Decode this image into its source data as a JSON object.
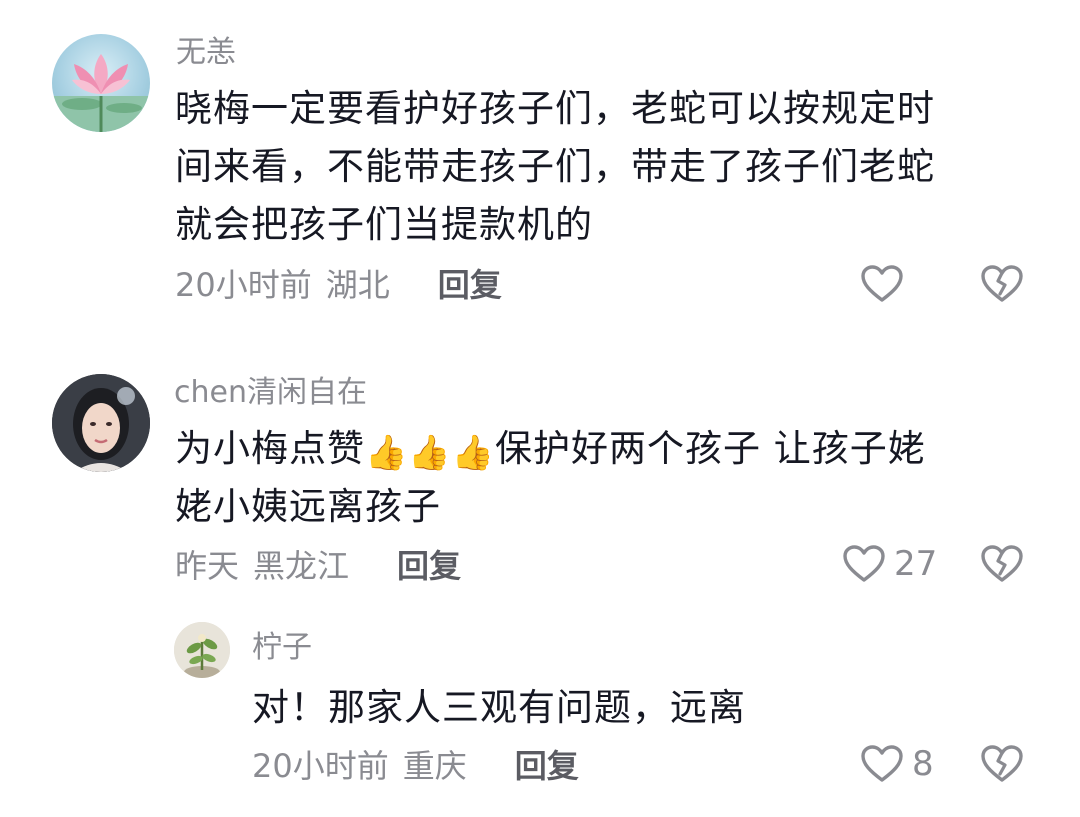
{
  "comments": [
    {
      "username": "无恙",
      "text": "晓梅一定要看护好孩子们，老蛇可以按规定时间来看，不能带走孩子们，带走了孩子们老蛇就会把孩子们当提款机的",
      "lines": [
        "晓梅一定要看护好孩子们，老蛇可以按规定时",
        "间来看，不能带走孩子们，带走了孩子们老蛇",
        "就会把孩子们当提款机的"
      ],
      "time": "20小时前",
      "location": "湖北",
      "reply_label": "回复",
      "like_count": "",
      "avatar_icon": "lotus-flower-avatar"
    },
    {
      "username": "chen清闲自在",
      "line1_before": "为小梅点赞",
      "emojis": [
        "👍",
        "👍",
        "👍"
      ],
      "line1_after": "保护好两个孩子 让孩子姥",
      "line2": "姥小姨远离孩子",
      "time": "昨天",
      "location": "黑龙江",
      "reply_label": "回复",
      "like_count": "27",
      "avatar_icon": "woman-portrait-avatar"
    },
    {
      "username": "柠子",
      "text": "对！那家人三观有问题，远离",
      "time": "20小时前",
      "location": "重庆",
      "reply_label": "回复",
      "like_count": "8",
      "avatar_icon": "plant-avatar"
    }
  ],
  "colors": {
    "text": "#161823",
    "secondary": "#8a8b91",
    "reply": "#5b5c63",
    "icon": "#8a8b91"
  },
  "icons": {
    "like": "heart-outline-icon",
    "dislike": "broken-heart-outline-icon"
  }
}
